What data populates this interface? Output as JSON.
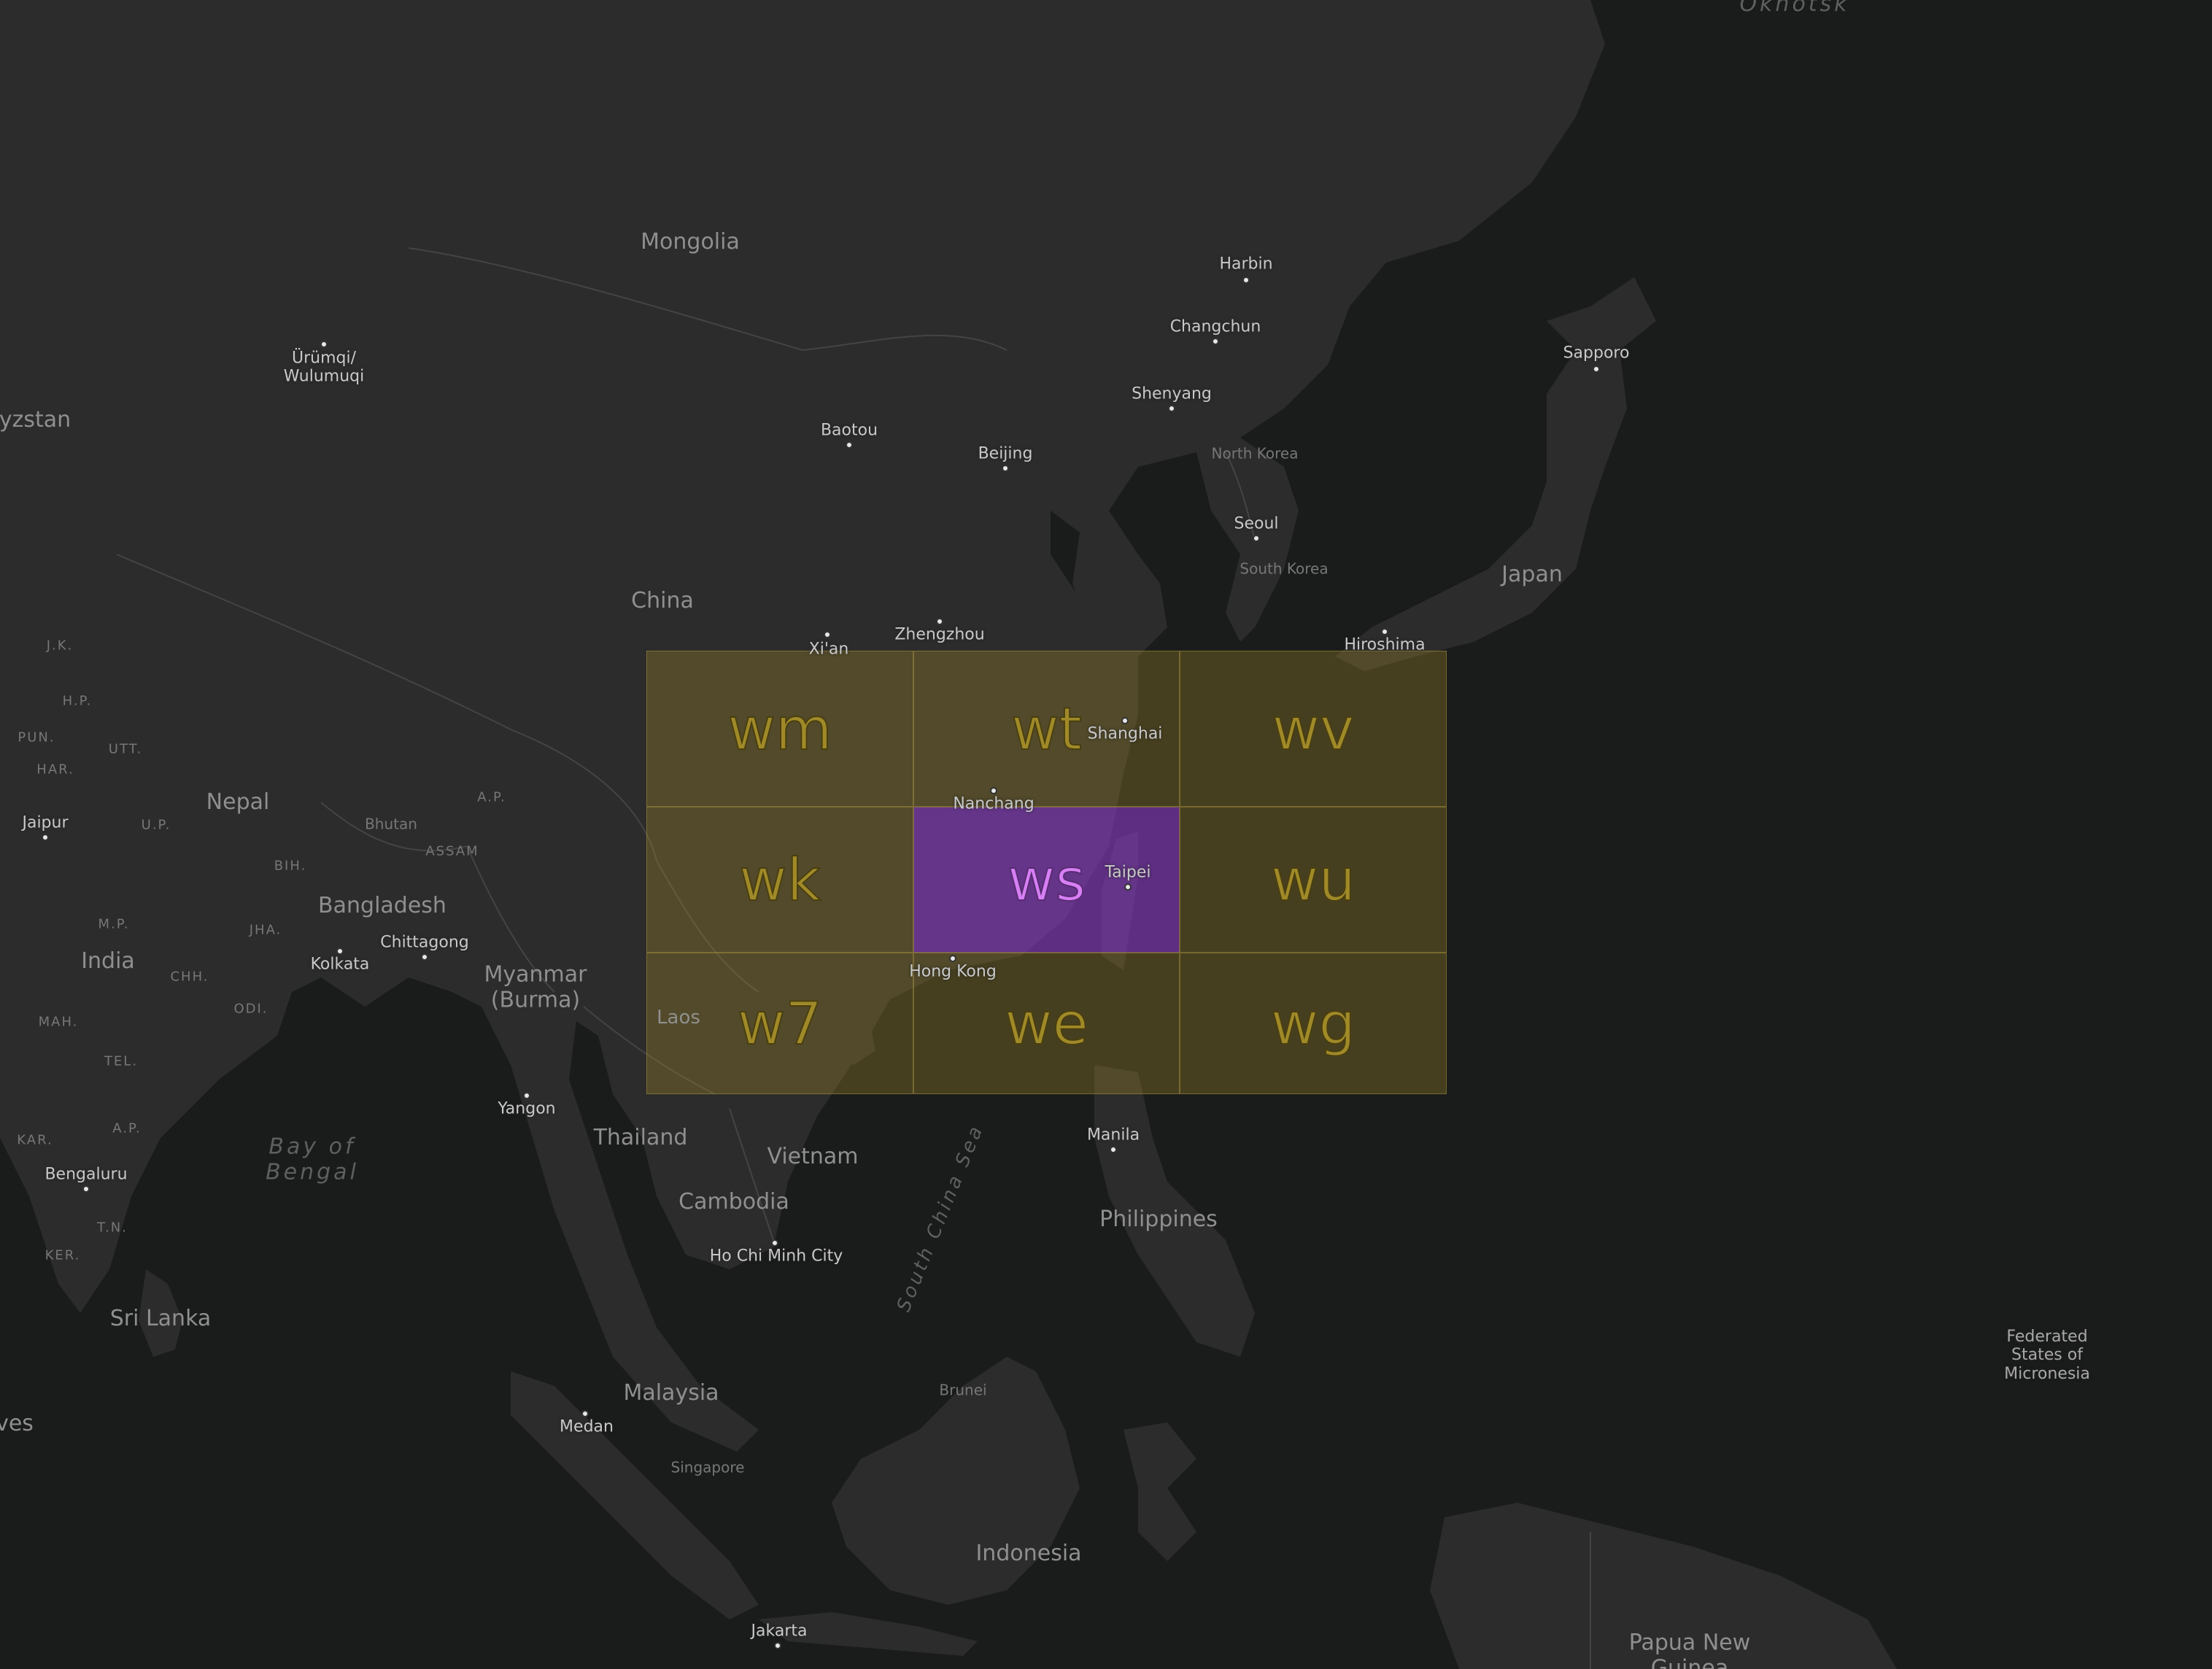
{
  "map": {
    "countries": [
      {
        "id": "mongolia",
        "text": "Mongolia"
      },
      {
        "id": "china",
        "text": "China"
      },
      {
        "id": "kyrgyzstan",
        "text": "yzstan"
      },
      {
        "id": "nepal",
        "text": "Nepal"
      },
      {
        "id": "bhutan",
        "text": "Bhutan"
      },
      {
        "id": "bangladesh",
        "text": "Bangladesh"
      },
      {
        "id": "india",
        "text": "India"
      },
      {
        "id": "myanmar",
        "text": "Myanmar\n(Burma)"
      },
      {
        "id": "laos",
        "text": "Laos"
      },
      {
        "id": "thailand",
        "text": "Thailand"
      },
      {
        "id": "vietnam",
        "text": "Vietnam"
      },
      {
        "id": "cambodia",
        "text": "Cambodia"
      },
      {
        "id": "philippines",
        "text": "Philippines"
      },
      {
        "id": "malaysia",
        "text": "Malaysia"
      },
      {
        "id": "indonesia",
        "text": "Indonesia"
      },
      {
        "id": "srilanka",
        "text": "Sri Lanka"
      },
      {
        "id": "japan",
        "text": "Japan"
      },
      {
        "id": "northkorea",
        "text": "North Korea"
      },
      {
        "id": "southkorea",
        "text": "South Korea"
      },
      {
        "id": "papua",
        "text": "Papua New\nGuinea"
      },
      {
        "id": "micronesia",
        "text": "Federated\nStates of\nMicronesia"
      },
      {
        "id": "maldives",
        "text": "ves"
      },
      {
        "id": "brunei",
        "text": "Brunei"
      },
      {
        "id": "singapore",
        "text": "Singapore"
      }
    ],
    "cities": [
      {
        "id": "urumqi",
        "text": "Ürümqi/\nWulumuqi"
      },
      {
        "id": "baotou",
        "text": "Baotou"
      },
      {
        "id": "beijing",
        "text": "Beijing"
      },
      {
        "id": "harbin",
        "text": "Harbin"
      },
      {
        "id": "changchun",
        "text": "Changchun"
      },
      {
        "id": "shenyang",
        "text": "Shenyang"
      },
      {
        "id": "seoul",
        "text": "Seoul"
      },
      {
        "id": "sapporo",
        "text": "Sapporo"
      },
      {
        "id": "hiroshima",
        "text": "Hiroshima"
      },
      {
        "id": "xian",
        "text": "Xi'an"
      },
      {
        "id": "zhengzhou",
        "text": "Zhengzhou"
      },
      {
        "id": "shanghai",
        "text": "Shanghai"
      },
      {
        "id": "nanchang",
        "text": "Nanchang"
      },
      {
        "id": "taipei",
        "text": "Taipei"
      },
      {
        "id": "hongkong",
        "text": "Hong Kong"
      },
      {
        "id": "jaipur",
        "text": "Jaipur"
      },
      {
        "id": "kolkata",
        "text": "Kolkata"
      },
      {
        "id": "chittagong",
        "text": "Chittagong"
      },
      {
        "id": "yangon",
        "text": "Yangon"
      },
      {
        "id": "bengaluru",
        "text": "Bengaluru"
      },
      {
        "id": "manila",
        "text": "Manila"
      },
      {
        "id": "hochiminh",
        "text": "Ho Chi Minh City"
      },
      {
        "id": "medan",
        "text": "Medan"
      },
      {
        "id": "jakarta",
        "text": "Jakarta"
      }
    ],
    "regions": [
      {
        "id": "jk",
        "text": "J.K."
      },
      {
        "id": "hp",
        "text": "H.P."
      },
      {
        "id": "pun",
        "text": "PUN."
      },
      {
        "id": "utt",
        "text": "UTT."
      },
      {
        "id": "har",
        "text": "HAR."
      },
      {
        "id": "up",
        "text": "U.P."
      },
      {
        "id": "ap1",
        "text": "A.P."
      },
      {
        "id": "assam",
        "text": "ASSAM"
      },
      {
        "id": "bih",
        "text": "BIH."
      },
      {
        "id": "mp",
        "text": "M.P."
      },
      {
        "id": "jha",
        "text": "JHA."
      },
      {
        "id": "chh",
        "text": "CHH."
      },
      {
        "id": "odi",
        "text": "ODI."
      },
      {
        "id": "mah",
        "text": "MAH."
      },
      {
        "id": "tel",
        "text": "TEL."
      },
      {
        "id": "ap2",
        "text": "A.P."
      },
      {
        "id": "kar",
        "text": "KAR."
      },
      {
        "id": "tn",
        "text": "T.N."
      },
      {
        "id": "ker",
        "text": "KER."
      }
    ],
    "water": [
      {
        "id": "bayofbengal",
        "text": "Bay of\nBengal"
      },
      {
        "id": "southchinasea",
        "text": "South China Sea"
      },
      {
        "id": "okhotsk",
        "text": "Okhotsk"
      }
    ]
  },
  "geohash": {
    "selected": "ws",
    "cells": [
      [
        "wm",
        "wt",
        "wv"
      ],
      [
        "wk",
        "ws",
        "wu"
      ],
      [
        "w7",
        "we",
        "wg"
      ]
    ]
  },
  "colors": {
    "cell_fill": "#a08a28",
    "selected_fill": "#9b3fd0",
    "land": "#2b2b2b",
    "water": "#1a1b1b"
  }
}
